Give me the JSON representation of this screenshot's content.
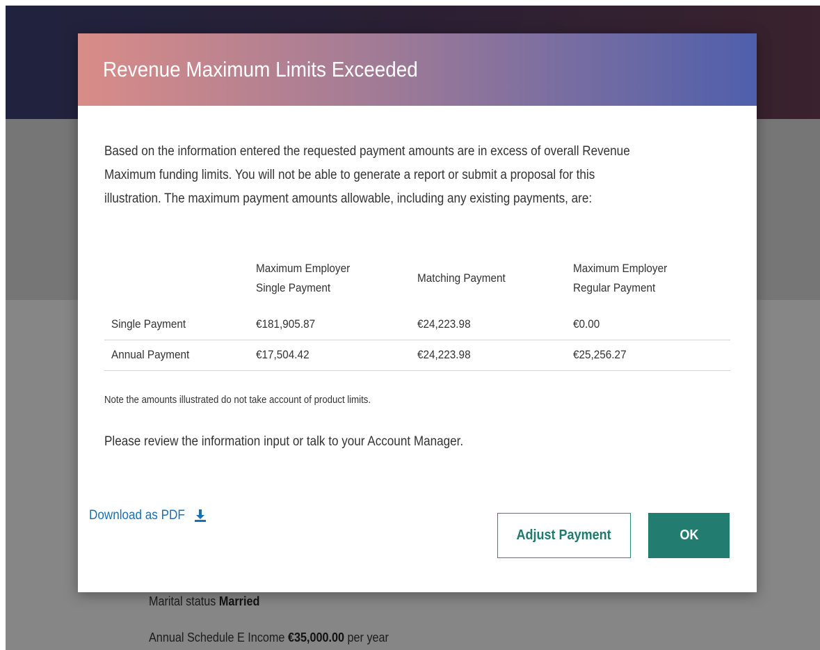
{
  "modal": {
    "title": "Revenue Maximum Limits Exceeded",
    "intro_lines": [
      "Based on the information entered the requested payment amounts are in excess of overall Revenue",
      "Maximum funding limits. You will not be able to generate a report or submit a proposal for this",
      "illustration. The maximum payment amounts allowable, including any existing payments, are:"
    ],
    "table": {
      "headers": [
        "",
        "Maximum Employer Single Payment",
        "Matching Payment",
        "Maximum Employer Regular Payment"
      ],
      "header_lines": [
        [
          ""
        ],
        [
          "Maximum Employer",
          "Single Payment"
        ],
        [
          "Matching Payment"
        ],
        [
          "Maximum Employer",
          "Regular Payment"
        ]
      ],
      "rows": [
        [
          "Single Payment",
          "€181,905.87",
          "€24,223.98",
          "€0.00"
        ],
        [
          "Annual Payment",
          "€17,504.42",
          "€24,223.98",
          "€25,256.27"
        ]
      ]
    },
    "note": "Note the amounts illustrated do not take account of product limits.",
    "review": "Please review the information input or talk to your Account Manager.",
    "download_label": "Download as PDF",
    "adjust_button": "Adjust Payment",
    "ok_button": "OK"
  },
  "background": {
    "marital_label": "Marital status ",
    "marital_value": "Married",
    "income_label": "Annual Schedule E Income ",
    "income_value": "€35,000.00",
    "income_suffix": " per year"
  },
  "colors": {
    "header_gradient_start": "#d98c88",
    "header_gradient_end": "#4f5fac",
    "primary_button": "#227d70",
    "link": "#1b6fb3"
  }
}
